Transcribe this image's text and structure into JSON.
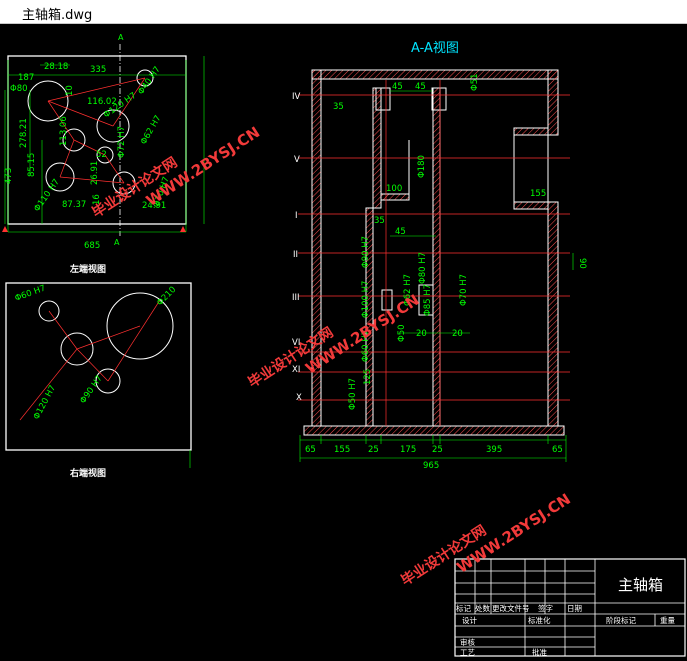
{
  "window": {
    "title": "主轴箱.dwg"
  },
  "left_view": {
    "caption": "左端视图",
    "section_mark": "A",
    "dims": {
      "d335": "335",
      "d187": "187",
      "d28_18": "28.18",
      "phi_left": "Φ80",
      "h10": "10",
      "d116": "116.02",
      "phi40": "Φ40 H7",
      "phi120": "Φ120 H7",
      "d278": "278.21",
      "d113": "113.06",
      "d85": "85.15",
      "d52": "52",
      "d473": "473",
      "phi110": "Φ110 H7",
      "d87": "87.37",
      "d26": "26.91",
      "d16": "16",
      "phi72": "Φ72 H7",
      "phi62": "Φ62 H7",
      "d24": "24.91",
      "phi70": "Φ70 H7",
      "d685": "685"
    }
  },
  "right_view": {
    "caption": "右端视图",
    "dims": {
      "phi60": "Φ60 H7",
      "phi210": "Φ210",
      "phi120": "Φ120 H7",
      "phi90": "Φ90 H7"
    }
  },
  "section_view": {
    "title": "A-A视图",
    "roman": [
      "IV",
      "V",
      "I",
      "II",
      "III",
      "VI",
      "XI",
      "X"
    ],
    "dims": {
      "d35": "35",
      "d45a": "45",
      "d45b": "45",
      "phi_top": "Φ51",
      "phi180": "Φ180",
      "d100": "100",
      "d155r": "155",
      "d35b": "35",
      "d45c": "45",
      "d90": "90",
      "phi90": "Φ90 H7",
      "phi80": "Φ80 H7",
      "phi100": "Φ100 H7",
      "phi62": "Φ62 H7",
      "phi50": "Φ50",
      "phi60": "Φ60 H7",
      "d20a": "20",
      "d20b": "20",
      "phi50h": "Φ50 H7",
      "d125": "125",
      "phi85": "Φ85 H7",
      "phi70": "Φ70 H7",
      "bottom": [
        "65",
        "155",
        "25",
        "175",
        "25",
        "395",
        "65"
      ],
      "total": "965"
    }
  },
  "title_block": {
    "title": "主轴箱",
    "cells": {
      "biaoji": "标记",
      "chushu": "处数",
      "gengai": "更改文件号",
      "qianzi": "签字",
      "riqi": "日期",
      "sheji": "设计",
      "biaozhunhua": "标准化",
      "jieduan": "阶段标记",
      "zhongliang": "重量",
      "shenhe": "审核",
      "gongyi": "工艺",
      "pizhun": "批准"
    }
  },
  "watermark": {
    "text": "毕业设计论文网",
    "url": "WWW.2BYSJ.CN"
  },
  "colors": {
    "outline": "#ffffff",
    "dimension": "#00ff00",
    "center": "#ff3030",
    "hatch": "#ff5050",
    "title": "#00e5ff",
    "watermark": "#ff3a3a"
  }
}
